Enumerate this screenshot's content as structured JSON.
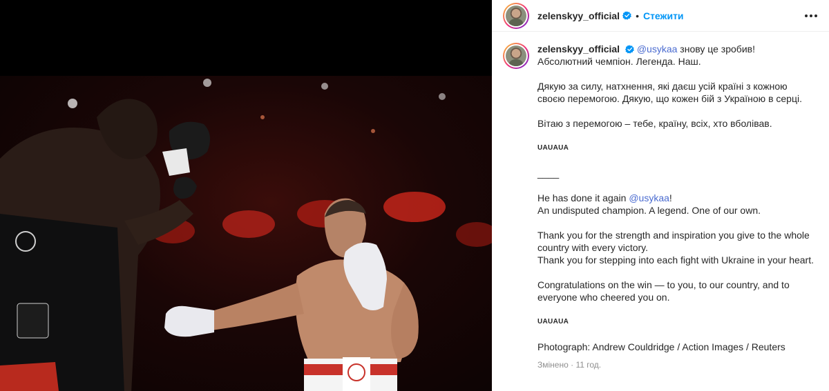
{
  "post": {
    "username": "zelenskyy_official",
    "follow_label": "Стежити",
    "dot": "•",
    "more_icon": "more-horizontal-icon"
  },
  "caption": {
    "username": "zelenskyy_official",
    "mention1": "@usykaa",
    "line1_rest": " знову це зробив!",
    "line2": "Абсолютний чемпіон. Легенда. Наш.",
    "p2": "Дякую за силу, натхнення, які даєш усій країні з кожною своєю перемогою. Дякую, що кожен бій з Україною в серці.",
    "p3": "Вітаю з перемогою – тебе, країну, всіх, хто вболівав.",
    "flags1": "UAUAUA",
    "divider": "____",
    "en1_start": "He has done it again ",
    "mention2": "@usykaa",
    "en1_end": "!",
    "en2": "An undisputed champion. A legend. One of our own.",
    "en3a": "Thank you for the strength and inspiration you give to the whole country with every victory.",
    "en3b": "Thank you for stepping into each fight with Ukraine in your heart.",
    "en4": "Congratulations on the win — to you, to our country, and to everyone who cheered you on.",
    "flags2": "UAUAUA",
    "photo_credit": "Photograph: Andrew Couldridge / Action Images / Reuters",
    "edited": "Змінено",
    "time": "11 год."
  },
  "colors": {
    "accent": "#0095f6",
    "verified": "#0095f6",
    "mention": "#4a6bd0"
  }
}
